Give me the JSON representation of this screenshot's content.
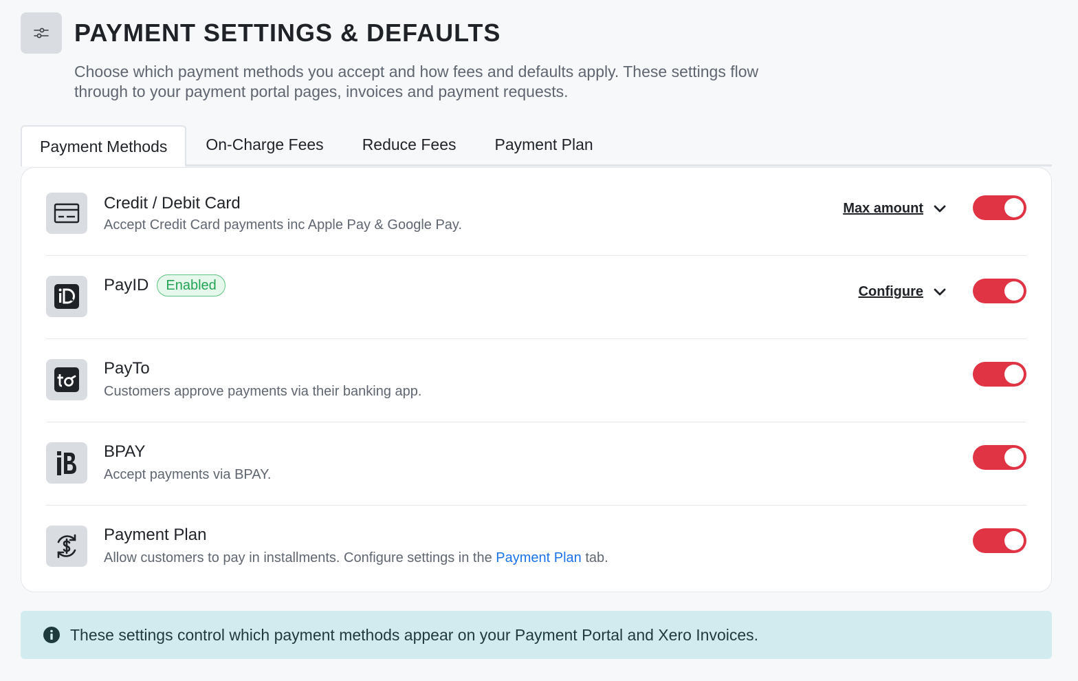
{
  "header": {
    "title": "PAYMENT SETTINGS & DEFAULTS",
    "icon": "sliders-icon",
    "description": "Choose which payment methods you accept and how fees and defaults apply. These settings flow through to your payment portal pages, invoices and payment requests."
  },
  "tabs": [
    {
      "label": "Payment Methods",
      "active": true
    },
    {
      "label": "On-Charge Fees",
      "active": false
    },
    {
      "label": "Reduce Fees",
      "active": false
    },
    {
      "label": "Payment Plan",
      "active": false
    }
  ],
  "methods": [
    {
      "title": "Credit / Debit Card",
      "description": "Accept Credit Card payments inc Apple Pay & Google Pay.",
      "icon": "credit-card-icon",
      "dropdown": "Max amount",
      "enabled": true
    },
    {
      "title": "PayID",
      "badge": "Enabled",
      "icon": "payid-icon",
      "dropdown": "Configure",
      "enabled": true
    },
    {
      "title": "PayTo",
      "description": "Customers approve payments via their banking app.",
      "icon": "payto-icon",
      "enabled": true
    },
    {
      "title": "BPAY",
      "description": "Accept payments via BPAY.",
      "icon": "bpay-icon",
      "enabled": true
    },
    {
      "title": "Payment Plan",
      "description_prefix": "Allow customers to pay in installments. Configure settings in the ",
      "description_link": "Payment Plan",
      "description_suffix": " tab.",
      "icon": "recurring-dollar-icon",
      "enabled": true
    }
  ],
  "info": {
    "icon": "info-icon",
    "text": "These settings control which payment methods appear on your Payment Portal and Xero Invoices."
  },
  "colors": {
    "toggle_on": "#e03445",
    "badge_green": "#23a455",
    "link_blue": "#1a73e8",
    "info_bg": "#d2ebee"
  }
}
